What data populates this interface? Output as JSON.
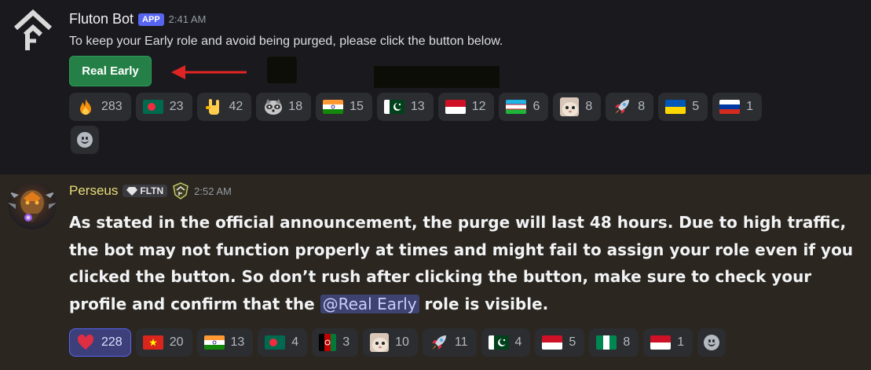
{
  "message1": {
    "username": "Fluton Bot",
    "tag": "APP",
    "time": "2:41 AM",
    "text": "To keep your Early role and avoid being purged, please click the button below.",
    "button_label": "Real Early",
    "reactions": [
      {
        "emoji": "fire",
        "count": "283"
      },
      {
        "emoji": "flag-bangladesh",
        "count": "23"
      },
      {
        "emoji": "sign-of-horns",
        "count": "42"
      },
      {
        "emoji": "raccoon",
        "count": "18"
      },
      {
        "emoji": "flag-india",
        "count": "15"
      },
      {
        "emoji": "flag-pakistan",
        "count": "13"
      },
      {
        "emoji": "flag-indonesia",
        "count": "12"
      },
      {
        "emoji": "flag-uzbekistan",
        "count": "6"
      },
      {
        "emoji": "cat-face",
        "count": "8"
      },
      {
        "emoji": "rocket",
        "count": "8"
      },
      {
        "emoji": "flag-ukraine",
        "count": "5"
      },
      {
        "emoji": "flag-russia",
        "count": "1"
      }
    ]
  },
  "message2": {
    "username": "Perseus",
    "guild_tag": "FLTN",
    "time": "2:52 AM",
    "text_before": "As stated in the official announcement, the purge will last 48 hours. Due to high traffic, the bot may not function properly at times and might fail to assign your role even if you clicked the button. So don’t rush after clicking the button, make sure to check your profile and confirm that the ",
    "mention": "@Real Early",
    "text_after": " role is visible.",
    "reactions": [
      {
        "emoji": "heart",
        "count": "228",
        "active": true
      },
      {
        "emoji": "flag-vietnam",
        "count": "20"
      },
      {
        "emoji": "flag-india",
        "count": "13"
      },
      {
        "emoji": "flag-bangladesh",
        "count": "4"
      },
      {
        "emoji": "flag-afghanistan",
        "count": "3"
      },
      {
        "emoji": "cat-face",
        "count": "10"
      },
      {
        "emoji": "rocket",
        "count": "11"
      },
      {
        "emoji": "flag-pakistan",
        "count": "4"
      },
      {
        "emoji": "flag-indonesia",
        "count": "5"
      },
      {
        "emoji": "flag-nigeria",
        "count": "8"
      },
      {
        "emoji": "flag-indonesia",
        "count": "1"
      }
    ]
  },
  "colors": {
    "accent": "#5865f2",
    "button_green": "#248046",
    "arrow_red": "#e02424",
    "perseus_name": "#e9de7b",
    "highlight_bg": "#2b2720"
  }
}
